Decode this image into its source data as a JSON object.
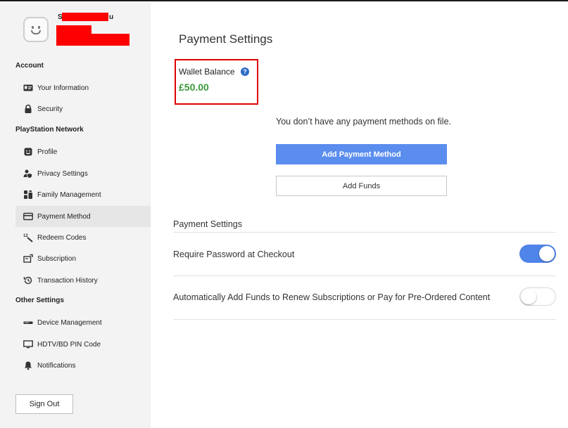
{
  "user": {
    "name_visible": "S",
    "name_tail": "u"
  },
  "sidebar": {
    "sections": [
      {
        "title": "Account"
      },
      {
        "title": "PlayStation Network"
      },
      {
        "title": "Other Settings"
      }
    ],
    "items": [
      {
        "label": "Your Information",
        "icon": "id-card-icon"
      },
      {
        "label": "Security",
        "icon": "lock-icon"
      },
      {
        "label": "Profile",
        "icon": "face-icon"
      },
      {
        "label": "Privacy Settings",
        "icon": "shield-person-icon"
      },
      {
        "label": "Family Management",
        "icon": "family-icon"
      },
      {
        "label": "Payment Method",
        "icon": "credit-card-icon",
        "active": true
      },
      {
        "label": "Redeem Codes",
        "icon": "code-wand-icon"
      },
      {
        "label": "Subscription",
        "icon": "subscription-icon"
      },
      {
        "label": "Transaction History",
        "icon": "history-icon"
      },
      {
        "label": "Device Management",
        "icon": "console-icon"
      },
      {
        "label": "HDTV/BD PIN Code",
        "icon": "monitor-icon"
      },
      {
        "label": "Notifications",
        "icon": "bell-icon"
      }
    ],
    "sign_out": "Sign Out"
  },
  "main": {
    "title": "Payment Settings",
    "wallet": {
      "label": "Wallet Balance",
      "help": "?",
      "amount": "£50.00"
    },
    "no_methods_text": "You don’t have any payment methods on file.",
    "add_payment_method": "Add Payment Method",
    "add_funds": "Add Funds",
    "settings_heading": "Payment Settings",
    "settings": [
      {
        "label": "Require Password at Checkout",
        "enabled": true
      },
      {
        "label": "Automatically Add Funds to Renew Subscriptions or Pay for Pre-Ordered Content",
        "enabled": false
      }
    ]
  },
  "colors": {
    "accent": "#5b8def",
    "toggle_on": "#4f84e8",
    "wallet_amount": "#3a9a3a",
    "highlight_box": "#e00000",
    "redaction": "#ff0000",
    "help_icon": "#2d6bc6"
  }
}
